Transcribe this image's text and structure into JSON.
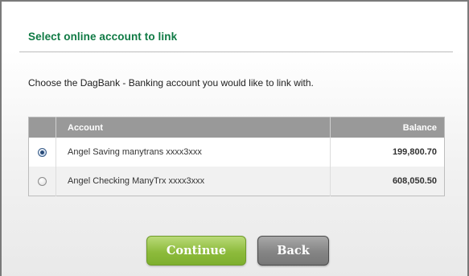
{
  "heading": "Select online account to link",
  "intro": "Choose the DagBank - Banking account you would like to link with.",
  "table": {
    "headers": {
      "radio": "",
      "account": "Account",
      "balance": "Balance"
    },
    "rows": [
      {
        "account": "Angel Saving manytrans xxxx3xxx",
        "balance": "199,800.70",
        "selected": true
      },
      {
        "account": "Angel Checking ManyTrx xxxx3xxx",
        "balance": "608,050.50",
        "selected": false
      }
    ]
  },
  "buttons": {
    "continue": "Continue",
    "back": "Back"
  },
  "colors": {
    "heading": "#0f7a44",
    "table_header": "#999999",
    "continue_button": "#8dbb3c",
    "back_button": "#858585"
  }
}
